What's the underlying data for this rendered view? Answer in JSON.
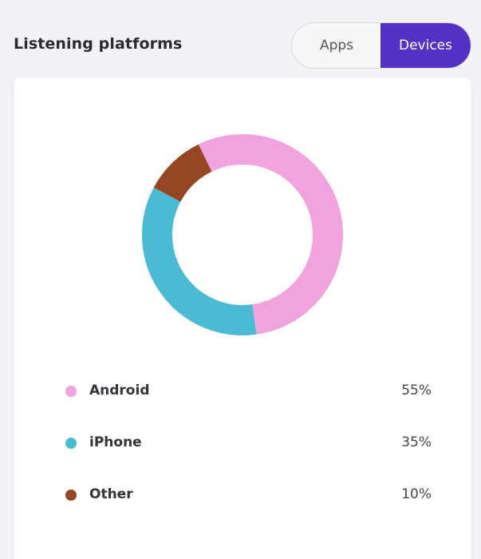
{
  "header": {
    "title": "Listening platforms",
    "toggle": {
      "options": [
        "Apps",
        "Devices"
      ],
      "selected": "Devices"
    }
  },
  "colors": {
    "accent": "#5331c4",
    "android": "#f0a3dc",
    "iphone": "#4bbbd4",
    "other": "#954622"
  },
  "chart_data": {
    "type": "pie",
    "variant": "donut",
    "categories": [
      "Android",
      "iPhone",
      "Other"
    ],
    "values": [
      55,
      35,
      10
    ],
    "value_labels": [
      "55%",
      "35%",
      "10%"
    ],
    "colors": [
      "#f0a3dc",
      "#4bbbd4",
      "#954622"
    ],
    "title": "",
    "legend": "below"
  }
}
